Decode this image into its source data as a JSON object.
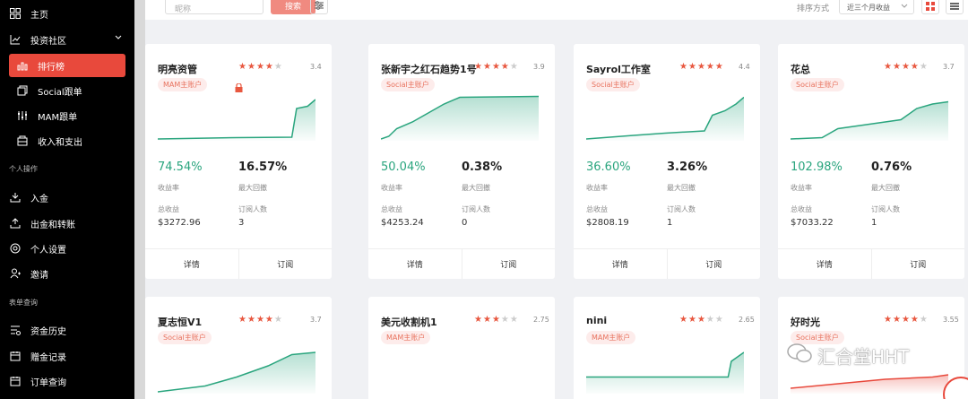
{
  "sidebar": {
    "home": "主页",
    "community": "投资社区",
    "ranking": "排行榜",
    "social_follow": "Social跟单",
    "mam_follow": "MAM跟单",
    "income": "收入和支出",
    "section_personal": "个人操作",
    "deposit": "入金",
    "withdraw": "出金和转账",
    "settings": "个人设置",
    "invite": "邀请",
    "section_reports": "表单查询",
    "fund_history": "资金历史",
    "gift_records": "赠金记录",
    "order_query": "订单查询"
  },
  "topbar": {
    "search_placeholder": "昵称",
    "search_button": "搜索",
    "sort_label": "排序方式",
    "sort_value": "近三个月收益"
  },
  "labels": {
    "return_rate": "收益率",
    "max_drawdown": "最大回撤",
    "total_profit": "总收益",
    "subscribers": "订阅人数",
    "details": "详情",
    "subscribe": "订阅"
  },
  "cards": [
    {
      "name": "明亮资管",
      "rating": "3.4",
      "stars": 3.5,
      "tag": "MAM主账户",
      "locked": true,
      "return": "74.54%",
      "drawdown": "16.57%",
      "profit": "$3272.96",
      "subscribers": "3",
      "curve": [
        [
          0,
          0.02
        ],
        [
          0.5,
          0.05
        ],
        [
          0.85,
          0.06
        ],
        [
          0.88,
          0.7
        ],
        [
          0.95,
          0.75
        ],
        [
          1,
          0.9
        ]
      ],
      "color": "#2aa57e"
    },
    {
      "name": "张新宇之红石趋势1号",
      "rating": "3.9",
      "stars": 4,
      "tag": "Social主账户",
      "locked": false,
      "return": "50.04%",
      "drawdown": "0.38%",
      "profit": "$4253.24",
      "subscribers": "0",
      "curve": [
        [
          0,
          0.02
        ],
        [
          0.05,
          0.08
        ],
        [
          0.1,
          0.25
        ],
        [
          0.2,
          0.4
        ],
        [
          0.3,
          0.6
        ],
        [
          0.4,
          0.8
        ],
        [
          0.5,
          0.95
        ],
        [
          1,
          0.97
        ]
      ],
      "color": "#2aa57e"
    },
    {
      "name": "Sayrol工作室",
      "rating": "4.4",
      "stars": 4.5,
      "tag": "Social主账户",
      "locked": false,
      "return": "36.60%",
      "drawdown": "3.26%",
      "profit": "$2808.19",
      "subscribers": "1",
      "curve": [
        [
          0,
          0.02
        ],
        [
          0.3,
          0.1
        ],
        [
          0.5,
          0.15
        ],
        [
          0.75,
          0.2
        ],
        [
          0.8,
          0.55
        ],
        [
          0.88,
          0.65
        ],
        [
          0.95,
          0.8
        ],
        [
          1,
          0.95
        ]
      ],
      "color": "#2aa57e"
    },
    {
      "name": "花总",
      "rating": "3.7",
      "stars": 3.5,
      "tag": "Social主账户",
      "locked": false,
      "return": "102.98%",
      "drawdown": "0.76%",
      "profit": "$7033.22",
      "subscribers": "1",
      "curve": [
        [
          0,
          0.02
        ],
        [
          0.2,
          0.05
        ],
        [
          0.3,
          0.25
        ],
        [
          0.5,
          0.35
        ],
        [
          0.7,
          0.45
        ],
        [
          0.8,
          0.7
        ],
        [
          0.9,
          0.8
        ],
        [
          1,
          0.85
        ]
      ],
      "color": "#2aa57e"
    },
    {
      "name": "夏志恒V1",
      "rating": "3.7",
      "stars": 3.5,
      "tag": "Social主账户",
      "locked": false,
      "return": "",
      "drawdown": "",
      "profit": "",
      "subscribers": "",
      "curve": [
        [
          0,
          0.02
        ],
        [
          0.3,
          0.15
        ],
        [
          0.5,
          0.35
        ],
        [
          0.7,
          0.6
        ],
        [
          0.85,
          0.85
        ],
        [
          1,
          0.9
        ]
      ],
      "color": "#2aa57e"
    },
    {
      "name": "美元收割机1",
      "rating": "2.75",
      "stars": 3,
      "tag": "MAM主账户",
      "locked": false,
      "return": "",
      "drawdown": "",
      "profit": "",
      "subscribers": "",
      "curve": [],
      "color": "#2aa57e"
    },
    {
      "name": "nini",
      "rating": "2.65",
      "stars": 2.5,
      "tag": "MAM主账户",
      "locked": false,
      "return": "",
      "drawdown": "",
      "profit": "",
      "subscribers": "",
      "curve": [
        [
          0,
          0.35
        ],
        [
          0.9,
          0.35
        ],
        [
          0.92,
          0.7
        ],
        [
          1,
          0.9
        ]
      ],
      "color": "#2aa57e"
    },
    {
      "name": "好时光",
      "rating": "3.55",
      "stars": 3.5,
      "tag": "Social主账户",
      "locked": false,
      "return": "",
      "drawdown": "",
      "profit": "",
      "subscribers": "",
      "curve": [
        [
          0,
          0.1
        ],
        [
          0.3,
          0.2
        ],
        [
          0.6,
          0.3
        ],
        [
          0.9,
          0.35
        ],
        [
          1,
          0.4
        ]
      ],
      "color": "#e8493c"
    }
  ],
  "watermark": "汇合堂HHT"
}
